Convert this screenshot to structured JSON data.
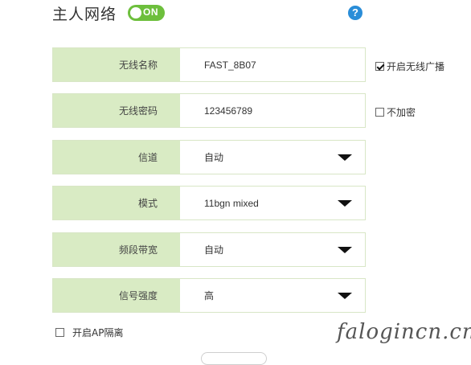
{
  "header": {
    "title": "主人网络",
    "toggle_label": "ON",
    "help_symbol": "?"
  },
  "rows": [
    {
      "label": "无线名称",
      "value": "FAST_8B07"
    },
    {
      "label": "无线密码",
      "value": "123456789"
    },
    {
      "label": "信道",
      "value": "自动"
    },
    {
      "label": "模式",
      "value": "11bgn mixed"
    },
    {
      "label": "频段带宽",
      "value": "自动"
    },
    {
      "label": "信号强度",
      "value": "高"
    }
  ],
  "options": {
    "broadcast": {
      "label": "开启无线广播",
      "checked": true
    },
    "no_encryption": {
      "label": "不加密",
      "checked": false
    },
    "ap_isolation": {
      "label": "开启AP隔离",
      "checked": false
    }
  },
  "watermark": "falogincn.cn",
  "colors": {
    "label_bg": "#d9ebc4",
    "toggle_on": "#6dbf3c",
    "help": "#2a8dd8"
  },
  "icons": {
    "dropdown": "caret-down-icon",
    "help": "help-icon",
    "checkbox": "checkbox-icon"
  }
}
